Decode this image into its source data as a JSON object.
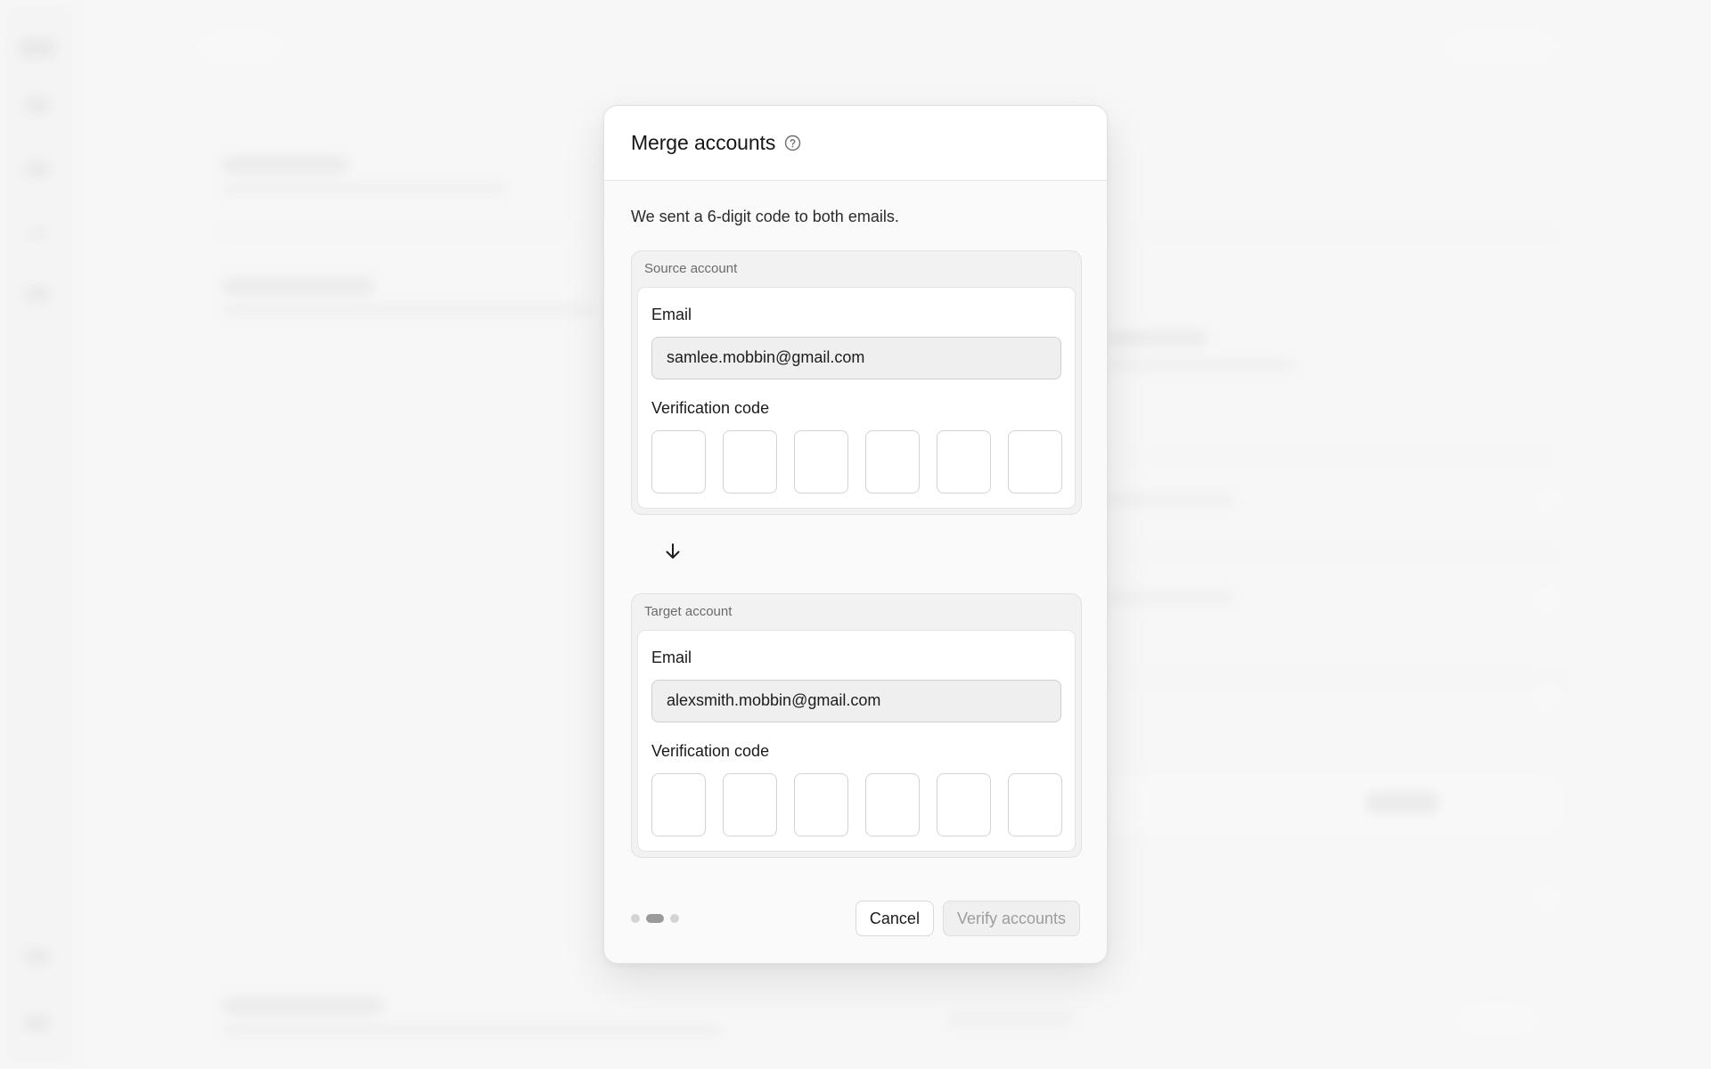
{
  "dialog": {
    "title": "Merge accounts",
    "help_icon": "question-circle-icon",
    "intro": "We sent a 6-digit code to both emails.",
    "source": {
      "group_label": "Source account",
      "email_label": "Email",
      "email_value": "samlee.mobbin@gmail.com",
      "code_label": "Verification code",
      "code_digits": [
        "",
        "",
        "",
        "",
        "",
        ""
      ]
    },
    "direction_icon": "arrow-down-icon",
    "target": {
      "group_label": "Target account",
      "email_label": "Email",
      "email_value": "alexsmith.mobbin@gmail.com",
      "code_label": "Verification code",
      "code_digits": [
        "",
        "",
        "",
        "",
        "",
        ""
      ]
    },
    "steps": {
      "total": 3,
      "current": 2
    },
    "buttons": {
      "cancel": "Cancel",
      "verify": "Verify accounts"
    }
  }
}
